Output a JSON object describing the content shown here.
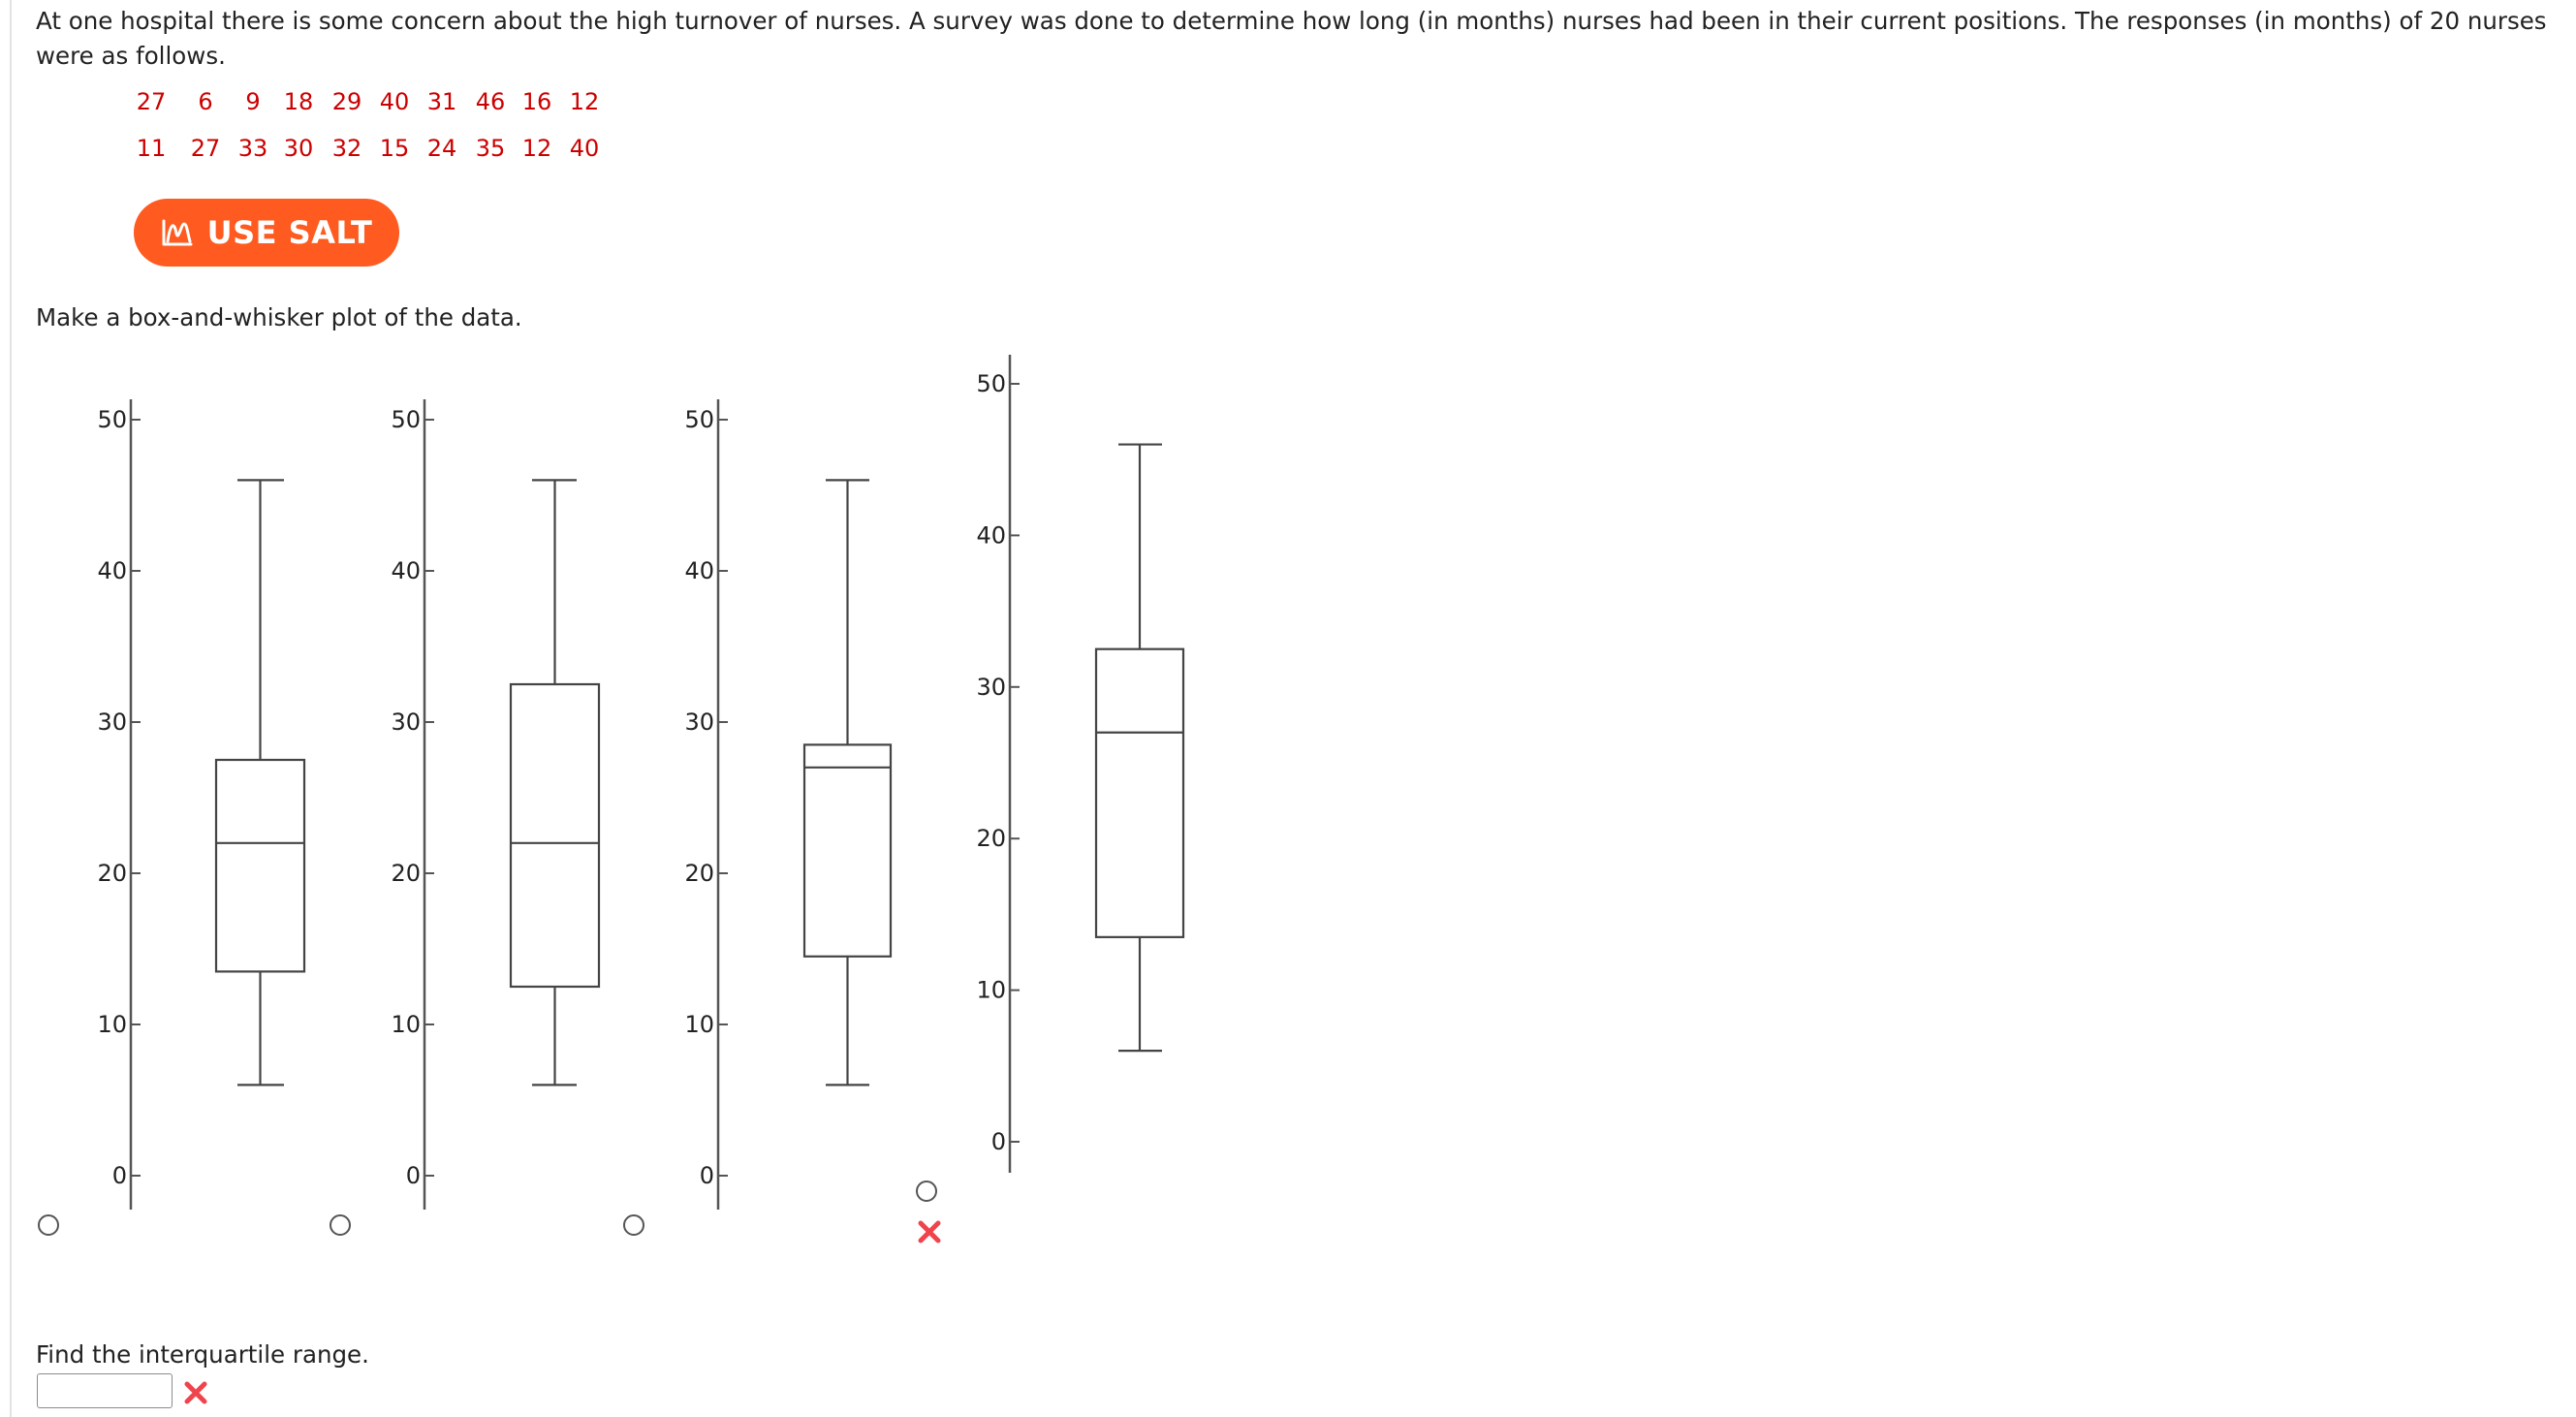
{
  "question": {
    "intro": "At one hospital there is some concern about the high turnover of nurses. A survey was done to determine how long (in months) nurses had been in their current positions. The responses (in months) of 20 nurses were as follows."
  },
  "dataset": {
    "row1": [
      "27",
      "6",
      "9",
      "18",
      "29",
      "40",
      "31",
      "46",
      "16",
      "12"
    ],
    "row2": [
      "11",
      "27",
      "33",
      "30",
      "32",
      "15",
      "24",
      "35",
      "12",
      "40"
    ]
  },
  "salt_button": {
    "label": "USE SALT",
    "color": "#ff5a1f"
  },
  "boxplot_prompt": "Make a box-and-whisker plot of the data.",
  "chart_data": [
    {
      "type": "boxplot",
      "orientation": "vertical",
      "ylim": [
        0,
        50
      ],
      "yticks": [
        "0",
        "10",
        "20",
        "30",
        "40",
        "50"
      ],
      "min": 6,
      "q1": 13.5,
      "median": 22,
      "q3": 27.5,
      "max": 46,
      "selected": false
    },
    {
      "type": "boxplot",
      "orientation": "vertical",
      "ylim": [
        0,
        50
      ],
      "yticks": [
        "0",
        "10",
        "20",
        "30",
        "40",
        "50"
      ],
      "min": 6,
      "q1": 12.5,
      "median": 22,
      "q3": 32.5,
      "max": 46,
      "selected": false
    },
    {
      "type": "boxplot",
      "orientation": "vertical",
      "ylim": [
        0,
        50
      ],
      "yticks": [
        "0",
        "10",
        "20",
        "30",
        "40",
        "50"
      ],
      "min": 6,
      "q1": 14.5,
      "median": 27,
      "q3": 28.5,
      "max": 46,
      "selected": false,
      "marked_incorrect": true
    },
    {
      "type": "boxplot",
      "orientation": "vertical",
      "ylim": [
        0,
        50
      ],
      "yticks": [
        "0",
        "10",
        "20",
        "30",
        "40",
        "50"
      ],
      "min": 6,
      "q1": 13.5,
      "median": 27,
      "q3": 32.5,
      "max": 46,
      "selected": false
    }
  ],
  "iqr": {
    "label": "Find the interquartile range.",
    "value": "",
    "marked_incorrect": true
  },
  "colors": {
    "data_text": "#cc0000",
    "wrong_mark": "#f0444d"
  }
}
